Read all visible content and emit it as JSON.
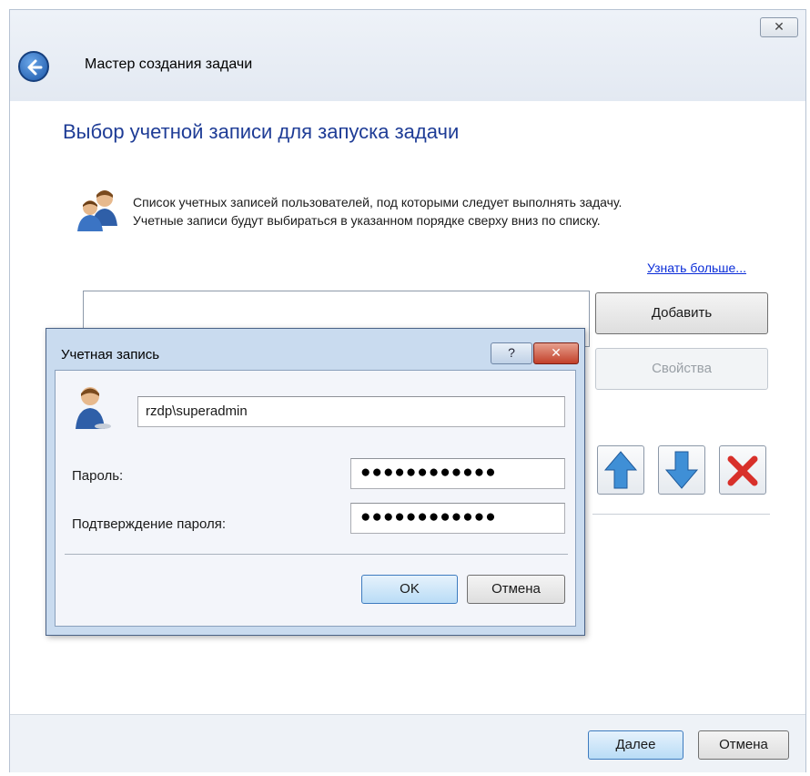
{
  "wizard": {
    "close_glyph": "✕",
    "title": "Мастер создания задачи",
    "heading": "Выбор учетной записи для запуска задачи",
    "description_line1": "Список учетных записей пользователей, под которыми следует выполнять задачу.",
    "description_line2": "Учетные записи будут выбираться в указанном порядке сверху вниз по списку.",
    "learn_more": "Узнать больше...",
    "add_button": "Добавить",
    "properties_button": "Свойства",
    "next_button": "Далее",
    "cancel_button": "Отмена",
    "icons": {
      "back": "back-arrow-icon",
      "users": "users-icon",
      "up": "arrow-up-icon",
      "down": "arrow-down-icon",
      "delete": "delete-x-icon"
    }
  },
  "dialog": {
    "title": "Учетная запись",
    "help_glyph": "?",
    "close_glyph": "✕",
    "username_value": "rzdp\\superadmin",
    "password_label": "Пароль:",
    "password_mask": "●●●●●●●●●●●●",
    "confirm_label": "Подтверждение пароля:",
    "confirm_mask": "●●●●●●●●●●●●",
    "ok_button": "OK",
    "cancel_button": "Отмена"
  },
  "colors": {
    "heading": "#1e3c96",
    "link": "#0a2cd8",
    "arrow_blue": "#3f8fd6",
    "delete_red": "#d8302a",
    "dialog_frame": "#c9dbef"
  }
}
